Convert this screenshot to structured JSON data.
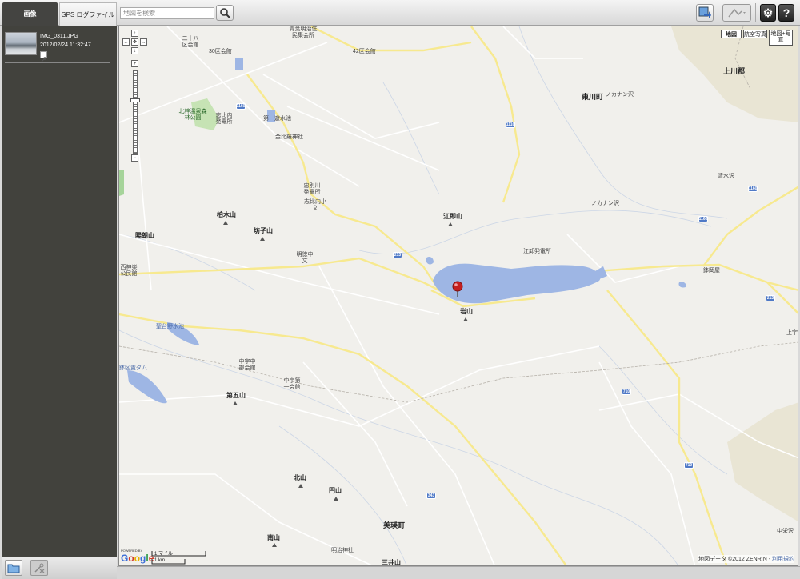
{
  "tabs": {
    "images": "画像",
    "gps_log": "GPS ログファイル"
  },
  "search": {
    "placeholder": "地図を検索"
  },
  "photo": {
    "name": "IMG_0311.JPG",
    "datetime": "2012/02/24 11:32:47"
  },
  "toolbar": {
    "settings": "⚙",
    "help": "?"
  },
  "colors": {
    "sidebar": "#42423d",
    "water": "#9eb6e4",
    "road": "#f7e98f",
    "pin": "#c41e1e"
  },
  "map": {
    "types": [
      "地図",
      "航空写真",
      "地図+写真"
    ],
    "selected_type": "地図",
    "scale": {
      "miles": "1 マイル",
      "km": "1 km"
    },
    "copyright": "地図データ ©2012 ZENRIN - ",
    "terms": "利用規約",
    "google": "Google",
    "powered": "POWERED BY",
    "labels": {
      "towns": [
        "東川町",
        "上川郡",
        "美瑛町"
      ],
      "mountains": [
        "柏木山",
        "陽朗山",
        "坊子山",
        "江即山",
        "岩山",
        "第五山",
        "北山",
        "円山",
        "南山",
        "三井山"
      ],
      "places": [
        "二十八区会館",
        "30区会館",
        "42区会館",
        "青葉明治住民集会所",
        "北梓温泉森林公園",
        "志比内発電所",
        "第一遊水池",
        "金比羅神社",
        "忠別川発電所",
        "志比内小文",
        "江卸発電所",
        "明徳中文",
        "西神楽公民館",
        "聖台野水池",
        "中宇中部会館",
        "中宇第一会館",
        "鉢区置ダム",
        "ノカナン沢",
        "清水沢",
        "鉢岡屋",
        "中栄沢",
        "明治神社",
        "上宇"
      ],
      "routes": [
        "1160",
        "1116",
        "213",
        "710",
        "343"
      ]
    }
  }
}
